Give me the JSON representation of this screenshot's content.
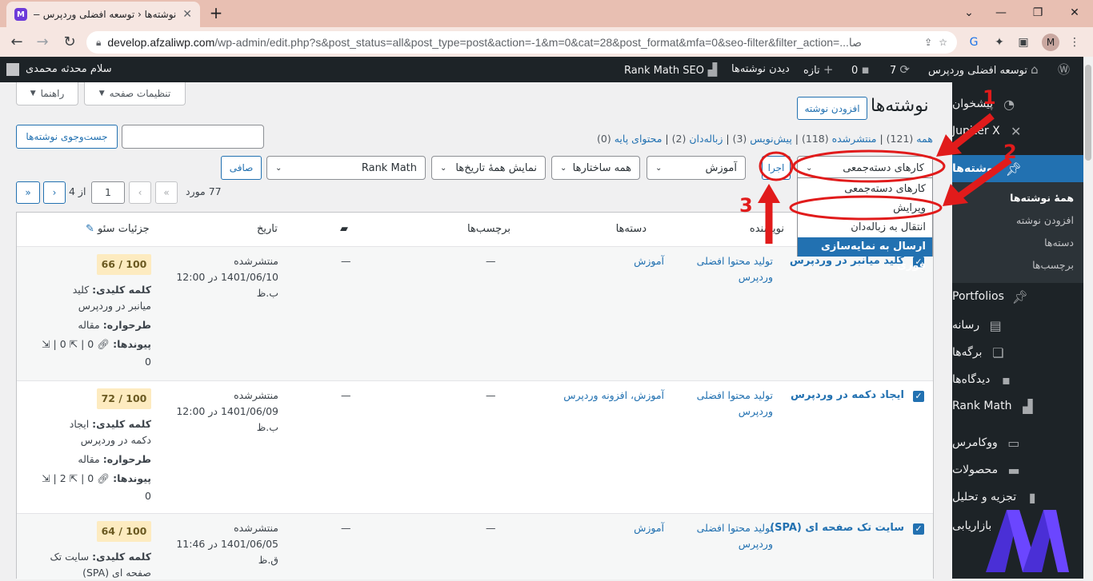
{
  "browser": {
    "tab_title": "نوشته‌ها ‹ توسعه افضلی وردپرس —",
    "url_host": "develop.afzaliwp.com",
    "url_path": "/wp-admin/edit.php?s&post_status=all&post_type=post&action=-1&m=0&cat=28&post_format&mfa=0&seo-filter&filter_action=...صا",
    "profile_initial": "M"
  },
  "adminbar": {
    "site_name": "توسعه افضلی وردپرس",
    "updates": "7",
    "comments": "0",
    "new": "تازه",
    "view_posts": "دیدن نوشته‌ها",
    "rank_math": "Rank Math SEO",
    "greeting": "سلام محدثه محمدی"
  },
  "sidebar": {
    "items": [
      {
        "label": "پیشخوان",
        "icon": "dashboard-icon"
      },
      {
        "label": "Jupiter X",
        "icon": "jupiterx-icon"
      },
      {
        "label": "نوشته‌ها",
        "icon": "pin-icon"
      },
      {
        "label": "Portfolios",
        "icon": "pin-icon"
      },
      {
        "label": "رسانه",
        "icon": "media-icon"
      },
      {
        "label": "برگه‌ها",
        "icon": "pages-icon"
      },
      {
        "label": "دیدگاه‌ها",
        "icon": "comments-icon"
      },
      {
        "label": "Rank Math",
        "icon": "rankmath-icon"
      },
      {
        "label": "ووکامرس",
        "icon": "woocommerce-icon"
      },
      {
        "label": "محصولات",
        "icon": "products-icon"
      },
      {
        "label": "تجزیه و تحلیل",
        "icon": "analytics-icon"
      },
      {
        "label": "بازاریابی",
        "icon": "megaphone-icon"
      }
    ],
    "submenu": [
      "همهٔ نوشته‌ها",
      "افزودن نوشته",
      "دسته‌ها",
      "برچسب‌ها"
    ]
  },
  "screen": {
    "screen_options": "تنظیمات صفحه",
    "help": "راهنما"
  },
  "page": {
    "title": "نوشته‌ها",
    "add_new": "افزودن نوشته",
    "search_button": "جست‌وجوی نوشته‌ها",
    "search_value": "",
    "views": [
      {
        "label": "همه",
        "count": "(121)"
      },
      {
        "label": "منتشرشده",
        "count": "(118)"
      },
      {
        "label": "پیش‌نویس",
        "count": "(3)"
      },
      {
        "label": "زباله‌دان",
        "count": "(2)"
      },
      {
        "label": "محتوای پایه",
        "count": "(0)"
      }
    ]
  },
  "filters": {
    "bulk_actions": "کارهای دسته‌جمعی",
    "apply": "اجرا",
    "category": "آموزش",
    "formats": "همه ساختارها",
    "dates": "نمایش همهٔ تاریخ‌ها",
    "rank_math": "Rank Math",
    "filter": "صافی"
  },
  "bulk_menu": {
    "options": [
      "کارهای دسته‌جمعی",
      "ویرایش",
      "انتقال به زباله‌دان",
      "ارسال به نمایه‌سازی فوری"
    ],
    "highlighted": 3
  },
  "pagination": {
    "items": "77 مورد",
    "page": "1",
    "of": "از 4",
    "first": "«",
    "prev": "‹",
    "next": "›",
    "last": "»"
  },
  "table": {
    "headers": {
      "author": "نویسنده",
      "categories": "دسته‌ها",
      "tags": "برچسب‌ها",
      "comments_icon": "comment-bubble-icon",
      "date": "تاریخ",
      "seo": "جزئیات سئو"
    },
    "rows": [
      {
        "title": "کلید میانبر در وردپرس",
        "author": "تولید محتوا افضلی وردپرس",
        "categories": "آموزش",
        "tags": "—",
        "comments": "—",
        "status": "منتشرشده",
        "date": "1401/06/10 در 12:00",
        "time_suffix": "ب.ظ",
        "score": "66 / 100",
        "keyword_label": "کلمه کلیدی:",
        "keyword": "کلید میانبر در وردپرس",
        "schema_label": "طرحواره:",
        "schema": "مقاله",
        "links_label": "پیوندها:",
        "internal": "0",
        "external": "0",
        "incoming": "0"
      },
      {
        "title": "ایجاد دکمه در وردپرس",
        "author": "تولید محتوا افضلی وردپرس",
        "categories": "آموزش، افزونه وردپرس",
        "tags": "—",
        "comments": "—",
        "status": "منتشرشده",
        "date": "1401/06/09 در 12:00",
        "time_suffix": "ب.ظ",
        "score": "72 / 100",
        "keyword_label": "کلمه کلیدی:",
        "keyword": "ایجاد دکمه در وردپرس",
        "schema_label": "طرحواره:",
        "schema": "مقاله",
        "links_label": "پیوندها:",
        "internal": "0",
        "external": "2",
        "incoming": "0"
      },
      {
        "title": "سایت تک صفحه ای (SPA)",
        "author": "تولید محتوا افضلی وردپرس",
        "categories": "آموزش",
        "tags": "—",
        "comments": "—",
        "status": "منتشرشده",
        "date": "1401/06/05 در 11:46",
        "time_suffix": "ق.ظ",
        "score": "64 / 100",
        "keyword_label": "کلمه کلیدی:",
        "keyword": "سایت تک صفحه ای (SPA)"
      }
    ]
  },
  "annotations": {
    "step1": "1",
    "step2": "2",
    "step3": "3"
  },
  "colors": {
    "accent": "#2271b1",
    "adminbar": "#1d2327",
    "annotation_red": "#e11b1b",
    "score_bg": "#fdebc0"
  }
}
